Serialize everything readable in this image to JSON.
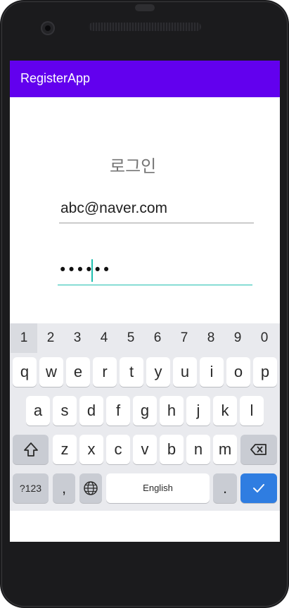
{
  "app": {
    "title": "RegisterApp"
  },
  "login": {
    "title": "로그인",
    "email_value": "abc@naver.com",
    "password_masked": "••••••"
  },
  "keyboard": {
    "numbers": [
      "1",
      "2",
      "3",
      "4",
      "5",
      "6",
      "7",
      "8",
      "9",
      "0"
    ],
    "row1": [
      "q",
      "w",
      "e",
      "r",
      "t",
      "y",
      "u",
      "i",
      "o",
      "p"
    ],
    "row2": [
      "a",
      "s",
      "d",
      "f",
      "g",
      "h",
      "j",
      "k",
      "l"
    ],
    "row3": [
      "z",
      "x",
      "c",
      "v",
      "b",
      "n",
      "m"
    ],
    "symbols_label": "?123",
    "comma_label": ",",
    "space_label": "English",
    "period_label": "."
  },
  "colors": {
    "appbar": "#6200ee",
    "accent": "#1fbfb0",
    "enter_key": "#2f7de1",
    "keyboard_bg": "#e9eaee"
  },
  "icons": {
    "shift": "shift-icon",
    "backspace": "backspace-icon",
    "globe": "globe-icon",
    "enter": "checkmark-icon"
  }
}
